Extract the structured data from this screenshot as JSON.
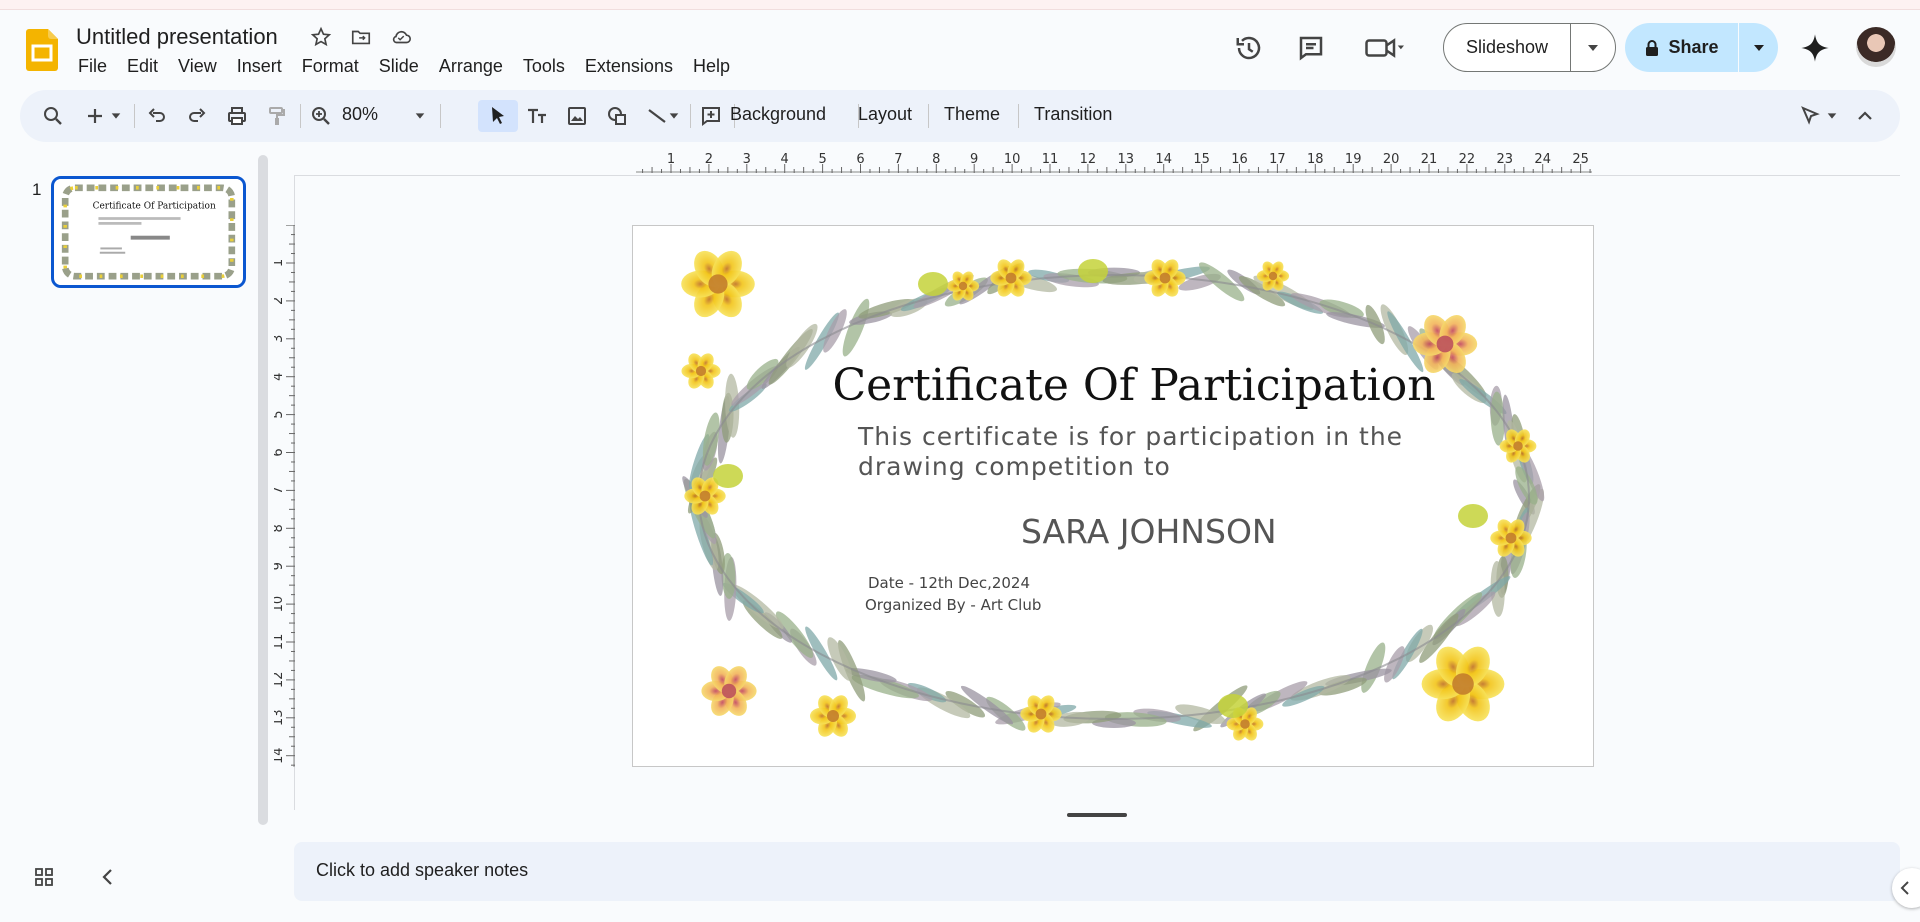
{
  "header": {
    "doc_title": "Untitled presentation",
    "menu": [
      "File",
      "Edit",
      "View",
      "Insert",
      "Format",
      "Slide",
      "Arrange",
      "Tools",
      "Extensions",
      "Help"
    ],
    "slideshow_label": "Slideshow",
    "share_label": "Share"
  },
  "toolbar": {
    "zoom": "80%",
    "background_label": "Background",
    "layout_label": "Layout",
    "theme_label": "Theme",
    "transition_label": "Transition"
  },
  "slides_panel": {
    "slide_number": "1"
  },
  "ruler": {
    "horizontal": [
      "1",
      "2",
      "3",
      "4",
      "5",
      "6",
      "7",
      "8",
      "9",
      "10",
      "11",
      "12",
      "13",
      "14",
      "15",
      "16",
      "17",
      "18",
      "19",
      "20",
      "21",
      "22",
      "23",
      "24",
      "25"
    ],
    "vertical": [
      "1",
      "2",
      "3",
      "4",
      "5",
      "6",
      "7",
      "8",
      "9",
      "10",
      "11",
      "12",
      "13",
      "14"
    ]
  },
  "slide": {
    "title": "Certificate Of Participation",
    "subtitle": "This certificate is for participation in the drawing competition to",
    "name": "SARA JOHNSON",
    "date": "Date - 12th Dec,2024",
    "organizer": "Organized By - Art Club"
  },
  "notes": {
    "placeholder": "Click to add speaker notes"
  },
  "colors": {
    "accent": "#0b57d0",
    "share_bg": "#c2e7ff",
    "toolbar_bg": "#edf2fa"
  }
}
